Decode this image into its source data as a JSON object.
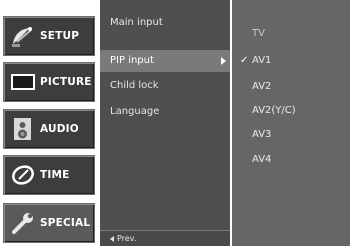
{
  "categories": [
    {
      "label": "SETUP",
      "icon": "satellite-dish-icon"
    },
    {
      "label": "PICTURE",
      "icon": "screen-icon"
    },
    {
      "label": "AUDIO",
      "icon": "speaker-icon"
    },
    {
      "label": "TIME",
      "icon": "clock-icon"
    },
    {
      "label": "SPECIAL",
      "icon": "wrench-icon"
    }
  ],
  "active_category": "SPECIAL",
  "submenu": {
    "items": [
      "Main input",
      "PIP input",
      "Child lock",
      "Language"
    ],
    "selected": "PIP input",
    "prev_label": "Prev."
  },
  "options": {
    "items": [
      "TV",
      "AV1",
      "AV2",
      "AV2(Y/C)",
      "AV3",
      "AV4"
    ],
    "checked": "AV1",
    "check_mark": "✓"
  },
  "colors": {
    "submenu_bg": "#4f4f4f",
    "selected_row": "#7a7a7a",
    "options_bg": "#666666"
  }
}
